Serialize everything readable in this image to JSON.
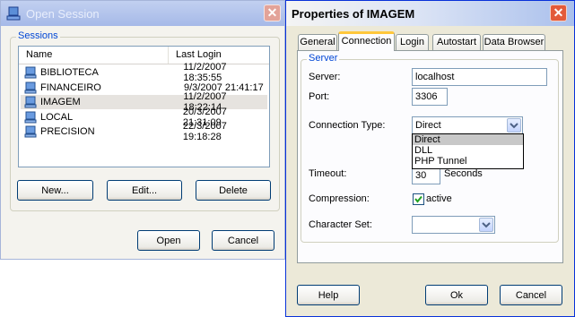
{
  "open_session": {
    "title": "Open Session",
    "group_label": "Sessions",
    "columns": [
      "Name",
      "Last Login"
    ],
    "sessions": [
      {
        "name": "BIBLIOTECA",
        "last_login": "11/2/2007 18:35:55",
        "selected": false
      },
      {
        "name": "FINANCEIRO",
        "last_login": "9/3/2007 21:41:17",
        "selected": false
      },
      {
        "name": "IMAGEM",
        "last_login": "11/2/2007 18:22:14",
        "selected": true
      },
      {
        "name": "LOCAL",
        "last_login": "20/3/2007 21:31:09",
        "selected": false
      },
      {
        "name": "PRECISION",
        "last_login": "22/3/2007 19:18:28",
        "selected": false
      }
    ],
    "buttons": {
      "new": "New...",
      "edit": "Edit...",
      "delete": "Delete",
      "open": "Open",
      "cancel": "Cancel"
    }
  },
  "properties": {
    "title": "Properties of IMAGEM",
    "tabs": [
      "General",
      "Connection",
      "Login",
      "Autostart",
      "Data Browser"
    ],
    "active_tab": "Connection",
    "group_label": "Server",
    "server_label": "Server:",
    "server_value": "localhost",
    "port_label": "Port:",
    "port_value": "3306",
    "connection_type_label": "Connection Type:",
    "connection_type_value": "Direct",
    "connection_type_options": [
      "Direct",
      "DLL",
      "PHP Tunnel"
    ],
    "timeout_label": "Timeout:",
    "timeout_value": "30",
    "timeout_unit": "Seconds",
    "compression_label": "Compression:",
    "compression_checked": true,
    "compression_option": "active",
    "charset_label": "Character Set:",
    "charset_value": "",
    "buttons": {
      "help": "Help",
      "ok": "Ok",
      "cancel": "Cancel"
    }
  },
  "colors": {
    "inactive_title": "#9eb3e3",
    "active_title_left": "#ffffff",
    "dialog_bg": "#ece9d8",
    "selection": "#e6e3df"
  }
}
